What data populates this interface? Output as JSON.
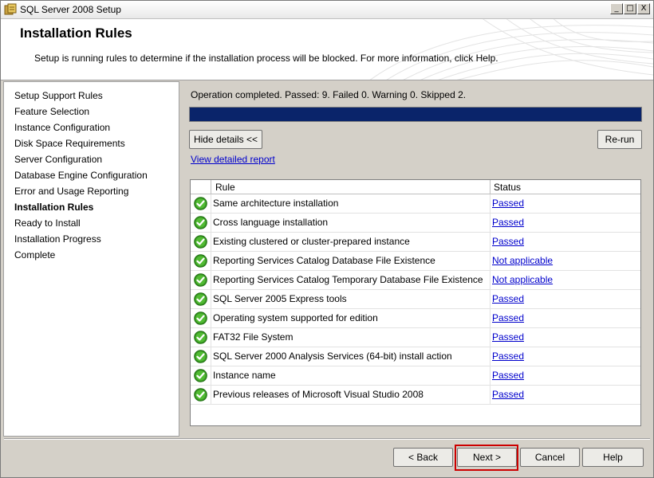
{
  "window": {
    "title": "SQL Server 2008 Setup",
    "controls": {
      "minimize": "_",
      "maximize": "□",
      "close": "X"
    }
  },
  "header": {
    "title": "Installation Rules",
    "description": "Setup is running rules to determine if the installation process will be blocked. For more information, click Help."
  },
  "sidebar": {
    "items": [
      {
        "label": "Setup Support Rules",
        "active": false
      },
      {
        "label": "Feature Selection",
        "active": false
      },
      {
        "label": "Instance Configuration",
        "active": false
      },
      {
        "label": "Disk Space Requirements",
        "active": false
      },
      {
        "label": "Server Configuration",
        "active": false
      },
      {
        "label": "Database Engine Configuration",
        "active": false
      },
      {
        "label": "Error and Usage Reporting",
        "active": false
      },
      {
        "label": "Installation Rules",
        "active": true
      },
      {
        "label": "Ready to Install",
        "active": false
      },
      {
        "label": "Installation Progress",
        "active": false
      },
      {
        "label": "Complete",
        "active": false
      }
    ]
  },
  "main": {
    "operation_status": "Operation completed. Passed: 9.   Failed 0.   Warning 0.   Skipped 2.",
    "progress_fraction": 1.0,
    "hide_details_label": "Hide details <<",
    "rerun_label": "Re-run",
    "view_report_label": "View detailed report",
    "table": {
      "headers": {
        "rule": "Rule",
        "status": "Status"
      },
      "rows": [
        {
          "rule": "Same architecture installation",
          "status": "Passed"
        },
        {
          "rule": "Cross language installation",
          "status": "Passed"
        },
        {
          "rule": "Existing clustered or cluster-prepared instance",
          "status": "Passed"
        },
        {
          "rule": "Reporting Services Catalog Database File Existence",
          "status": "Not applicable"
        },
        {
          "rule": "Reporting Services Catalog Temporary Database File Existence",
          "status": "Not applicable"
        },
        {
          "rule": "SQL Server 2005 Express tools",
          "status": "Passed"
        },
        {
          "rule": "Operating system supported for edition",
          "status": "Passed"
        },
        {
          "rule": "FAT32 File System",
          "status": "Passed"
        },
        {
          "rule": "SQL Server 2000 Analysis Services (64-bit) install action",
          "status": "Passed"
        },
        {
          "rule": "Instance name",
          "status": "Passed"
        },
        {
          "rule": "Previous releases of Microsoft Visual Studio 2008",
          "status": "Passed"
        }
      ]
    }
  },
  "footer": {
    "back_label": "< Back",
    "next_label": "Next >",
    "cancel_label": "Cancel",
    "help_label": "Help"
  },
  "icons": {
    "row_status": "green-check-icon",
    "app": "sql-setup-icon"
  },
  "colors": {
    "progress": "#0a246a",
    "link": "#0000cc",
    "check": "#3a9d23",
    "highlight": "#cc0000"
  }
}
